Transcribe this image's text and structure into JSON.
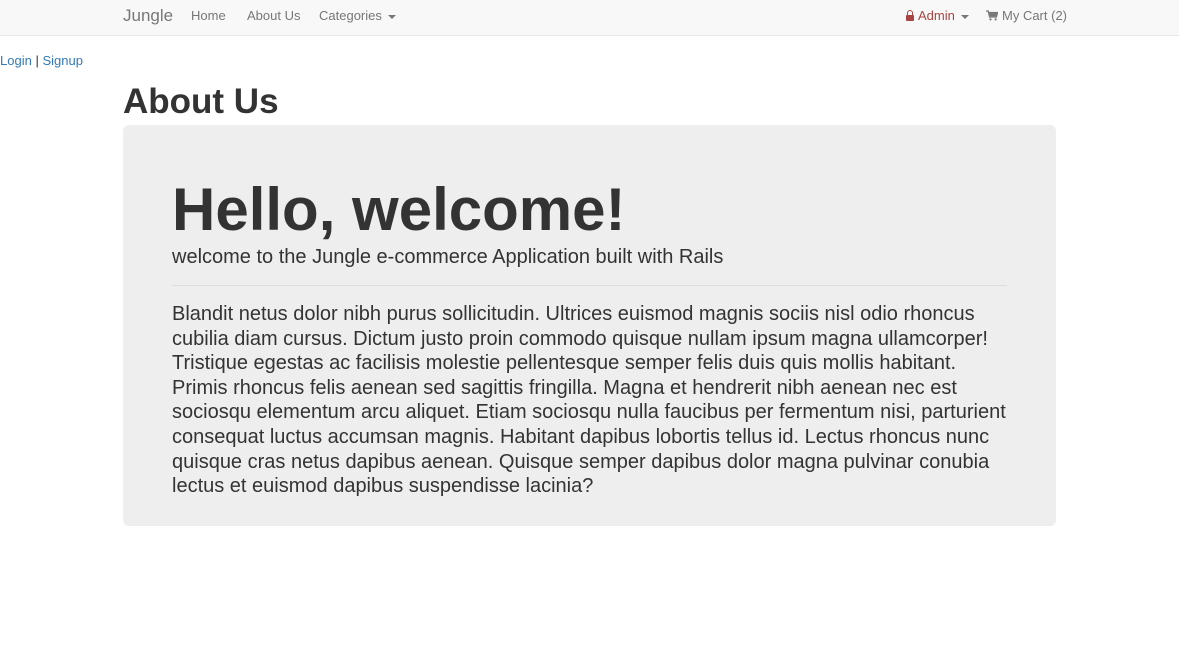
{
  "navbar": {
    "brand": "Jungle",
    "links": [
      {
        "label": "Home"
      },
      {
        "label": "About Us"
      },
      {
        "label": "Categories"
      }
    ],
    "admin": {
      "label": "Admin",
      "icon": "lock-icon",
      "color": "#a94442"
    },
    "cart": {
      "label": "My Cart (2)",
      "icon": "cart-icon"
    }
  },
  "auth": {
    "login": "Login",
    "separator": "|",
    "signup": "Signup",
    "link_color": "#337ab7"
  },
  "page": {
    "title": "About Us"
  },
  "jumbotron": {
    "heading": "Hello, welcome!",
    "lead": "welcome to the Jungle e-commerce Application built with Rails",
    "body": "Blandit netus dolor nibh purus sollicitudin. Ultrices euismod magnis sociis nisl odio rhoncus cubilia diam cursus. Dictum justo proin commodo quisque nullam ipsum magna ullamcorper! Tristique egestas ac facilisis molestie pellentesque semper felis duis quis mollis habitant. Primis rhoncus felis aenean sed sagittis fringilla. Magna et hendrerit nibh aenean nec est sociosqu elementum arcu aliquet. Etiam sociosqu nulla faucibus per fermentum nisi, parturient consequat luctus accumsan magnis. Habitant dapibus lobortis tellus id. Lectus rhoncus nunc quisque cras netus dapibus aenean. Quisque semper dapibus dolor magna pulvinar conubia lectus et euismod dapibus suspendisse lacinia?",
    "background": "#eeeeee"
  }
}
